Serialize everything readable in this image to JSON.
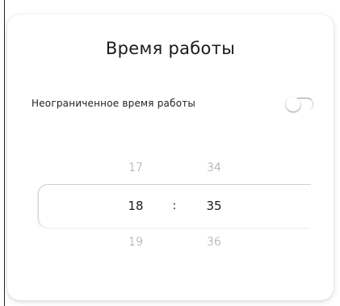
{
  "dialog": {
    "title": "Время работы",
    "unlimited_label": "Неограниченное время работы",
    "unlimited_enabled": false
  },
  "time_picker": {
    "hours": {
      "prev": "17",
      "selected": "18",
      "next": "19"
    },
    "separator": ":",
    "minutes": {
      "prev": "34",
      "selected": "35",
      "next": "36"
    }
  }
}
